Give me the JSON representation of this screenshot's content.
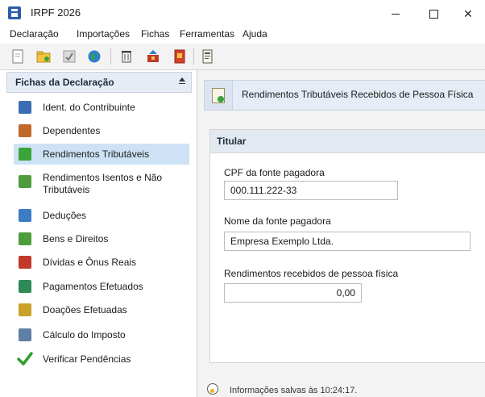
{
  "window": {
    "title": "IRPF 2026"
  },
  "window_controls": {
    "minimize": "−",
    "maximize": "□",
    "close": "✕"
  },
  "menu": [
    "Declaração",
    "Importações",
    "Fichas",
    "Ferramentas",
    "Ajuda"
  ],
  "toolbar_icons": [
    "new-file-icon",
    "open-folder-icon",
    "checklist-icon",
    "globe-icon",
    "trash-icon",
    "transmit-icon",
    "print-icon",
    "receipt-icon"
  ],
  "sidebar": {
    "title": "Fichas da Declaração",
    "items": [
      {
        "label": "Ident. do Contribuinte",
        "icon": "person-icon",
        "color": "#3b6db5"
      },
      {
        "label": "Dependentes",
        "icon": "people-icon",
        "color": "#c06a2a"
      },
      {
        "label": "Rendimentos Tributáveis",
        "icon": "document-coin-icon",
        "color": "#3aa33a",
        "active": true
      },
      {
        "label": "Rendimentos Isentos e Não Tributáveis",
        "icon": "document-plus-icon",
        "color": "#4f9c3d"
      },
      {
        "label": "Deduções",
        "icon": "deductions-icon",
        "color": "#3d7bc4"
      },
      {
        "label": "Bens e Direitos",
        "icon": "assets-icon",
        "color": "#4f9c3d"
      },
      {
        "label": "Dívidas e Ônus Reais",
        "icon": "debt-icon",
        "color": "#c0392b"
      },
      {
        "label": "Pagamentos Efetuados",
        "icon": "payments-icon",
        "color": "#2e8b57"
      },
      {
        "label": "Doações Efetuadas",
        "icon": "donation-icon",
        "color": "#c9a227"
      },
      {
        "label": "Cálculo do Imposto",
        "icon": "calculator-icon",
        "color": "#5f7fa6"
      },
      {
        "label": "Verificar Pendências",
        "icon": "checkmark-icon",
        "color": "#2e9e2e"
      }
    ]
  },
  "main": {
    "title": "Rendimentos Tributáveis Recebidos de Pessoa Física",
    "group_title": "Titular",
    "fields": {
      "cpf": {
        "label": "CPF da fonte pagadora",
        "value": "000.111.222-33"
      },
      "nome": {
        "label": "Nome da fonte pagadora",
        "value": "Empresa Exemplo Ltda."
      },
      "rendimentos": {
        "label": "Rendimentos recebidos de pessoa física",
        "value": "0,00"
      }
    }
  },
  "status": {
    "text": "Informações salvas às 10:24:17."
  },
  "colors": {
    "accent": "#cde3f5",
    "header_bg": "#e6ecf5"
  }
}
